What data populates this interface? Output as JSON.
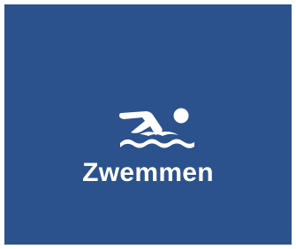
{
  "tile": {
    "label": "Zwemmen",
    "icon": "swimmer-icon",
    "background_color": "#2b528c",
    "foreground_color": "#ffffff"
  }
}
